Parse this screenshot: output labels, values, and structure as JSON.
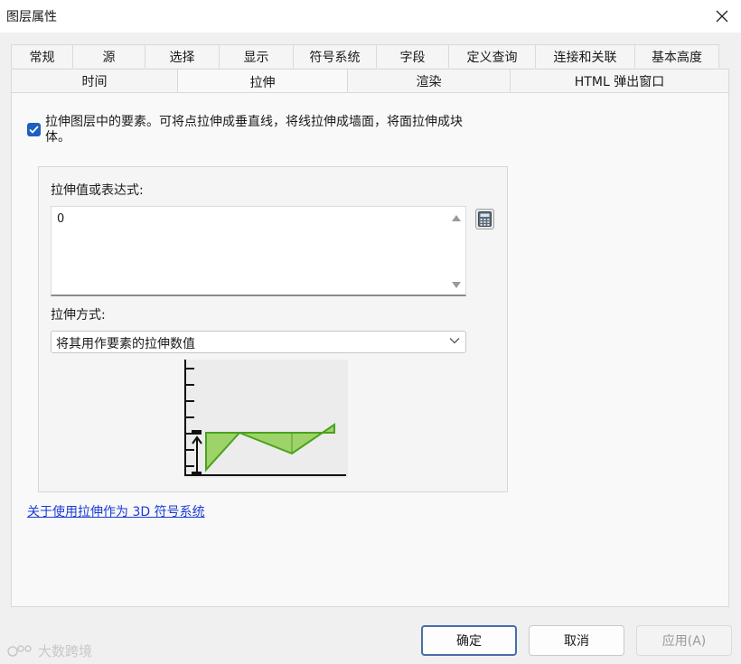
{
  "window": {
    "title": "图层属性"
  },
  "tabs": {
    "row1": [
      "常规",
      "源",
      "选择",
      "显示",
      "符号系统",
      "字段",
      "定义查询",
      "连接和关联",
      "基本高度"
    ],
    "row2": [
      "时间",
      "拉伸",
      "渲染",
      "HTML 弹出窗口"
    ],
    "active": "拉伸"
  },
  "extrusion": {
    "checkbox_checked": true,
    "checkbox_label": "拉伸图层中的要素。可将点拉伸成垂直线，将线拉伸成墙面，将面拉伸成块体。",
    "value_label": "拉伸值或表达式:",
    "value": "0",
    "method_label": "拉伸方式:",
    "method_value": "将其用作要素的拉伸数值"
  },
  "help_link": "关于使用拉伸作为 3D 符号系统",
  "buttons": {
    "ok": "确定",
    "cancel": "取消",
    "apply": "应用(A)"
  },
  "watermark": "大数跨境",
  "icons": {
    "close": "close-icon",
    "check": "checkmark-icon",
    "calculator": "calculator-icon",
    "chevron": "chevron-down-icon"
  },
  "colors": {
    "accent": "#1e5fbf",
    "link": "#1a3bd6",
    "diagram_fill": "#9ed36a",
    "diagram_stroke": "#4aa21c"
  }
}
